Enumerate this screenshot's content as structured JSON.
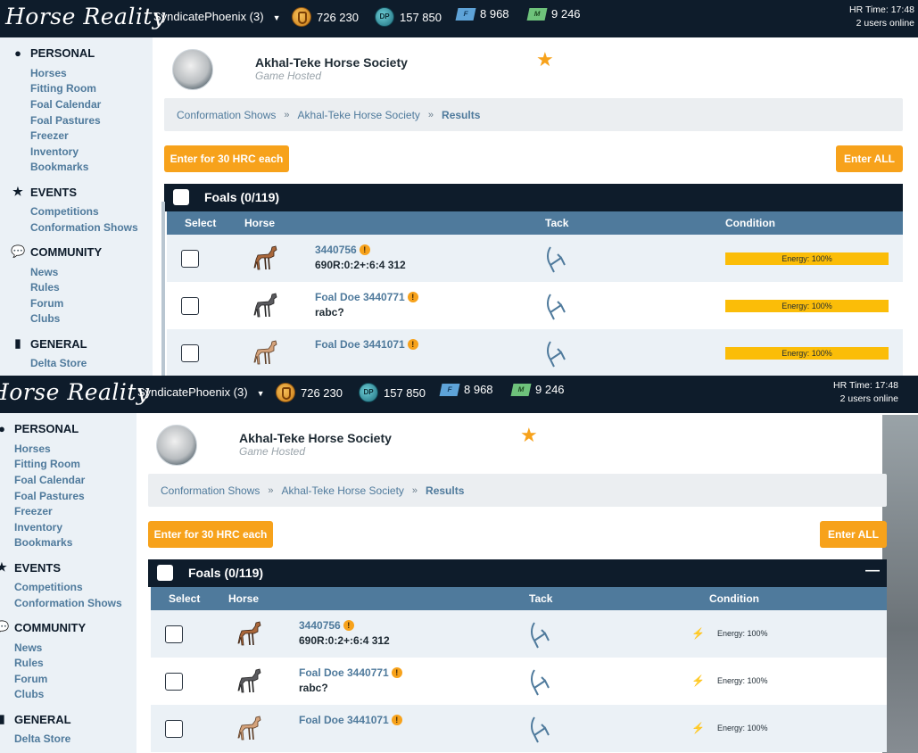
{
  "header": {
    "logo": "Horse Reality",
    "username": "SyndicatePhoenix (3)",
    "currencies": [
      {
        "icon": "gold-coin-icon",
        "value": "726 230"
      },
      {
        "icon": "dp-coin-icon",
        "value": "157 850"
      },
      {
        "icon": "blue-ticket-icon",
        "value": "8 968"
      },
      {
        "icon": "green-ticket-icon",
        "value": "9 246"
      }
    ],
    "hr_time": "HR Time: 17:48",
    "users_online": "2 users online"
  },
  "sidebar": {
    "personal": {
      "title": "PERSONAL",
      "items": [
        "Horses",
        "Fitting Room",
        "Foal Calendar",
        "Foal Pastures",
        "Freezer",
        "Inventory",
        "Bookmarks"
      ]
    },
    "events": {
      "title": "EVENTS",
      "items": [
        "Competitions",
        "Conformation Shows"
      ]
    },
    "community": {
      "title": "COMMUNITY",
      "items": [
        "News",
        "Rules",
        "Forum",
        "Clubs"
      ]
    },
    "general": {
      "title": "GENERAL",
      "items": [
        "Delta Store"
      ]
    }
  },
  "society": {
    "name": "Akhal-Teke Horse Society",
    "subtitle": "Game Hosted"
  },
  "breadcrumb": [
    "Conformation Shows",
    "Akhal-Teke Horse Society",
    "Results"
  ],
  "buttons": {
    "enter_each": "Enter for 30 HRC each",
    "enter_all": "Enter ALL"
  },
  "panel": {
    "title": "Foals (0/119)",
    "collapse_symbol": "—",
    "columns": {
      "select": "Select",
      "horse": "Horse",
      "tack": "Tack",
      "condition": "Condition"
    },
    "rows": [
      {
        "name": "3440756",
        "sub": "690R:0:2+:6:4 312",
        "energy": "Energy: 100%",
        "coat": "#a9673b"
      },
      {
        "name": "Foal Doe 3440771",
        "sub": "rabc?",
        "energy": "Energy: 100%",
        "coat": "#5a5a5e"
      },
      {
        "name": "Foal Doe 3441071",
        "sub": "",
        "energy": "Energy: 100%",
        "coat": "#d4a37c"
      }
    ]
  },
  "colors": {
    "navy": "#0e1c2b",
    "accent": "#f7a21b",
    "link": "#4f7a9c",
    "energy": "#fbbd08"
  }
}
